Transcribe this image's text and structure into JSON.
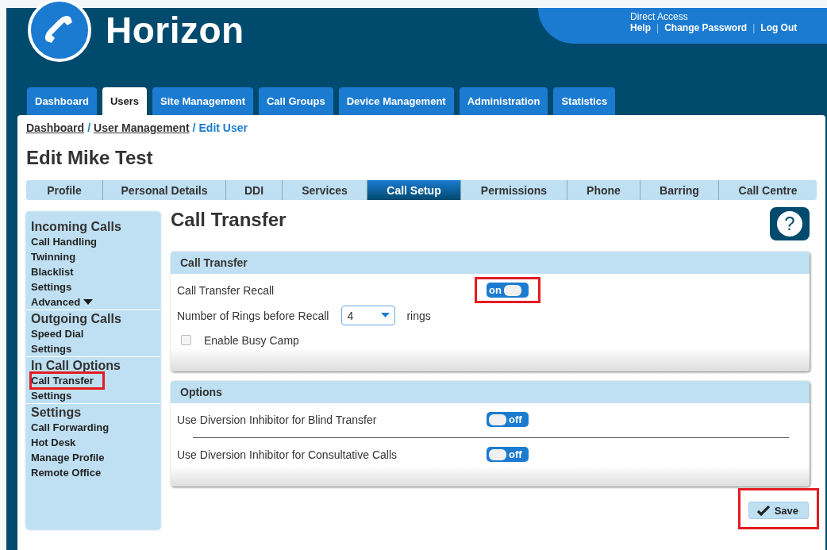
{
  "header": {
    "logo_text": "Horizon",
    "account_label": "Direct Access",
    "account_links": [
      "Help",
      "Change Password",
      "Log Out"
    ],
    "link_separator": "|"
  },
  "main_tabs": [
    {
      "label": "Dashboard",
      "selected": false
    },
    {
      "label": "Users",
      "selected": true
    },
    {
      "label": "Site Management",
      "selected": false
    },
    {
      "label": "Call Groups",
      "selected": false
    },
    {
      "label": "Device Management",
      "selected": false
    },
    {
      "label": "Administration",
      "selected": false
    },
    {
      "label": "Statistics",
      "selected": false
    }
  ],
  "breadcrumb_separator": "/",
  "breadcrumb": [
    {
      "label": "Dashboard",
      "current": false
    },
    {
      "label": "User Management",
      "current": false
    },
    {
      "label": "Edit User",
      "current": true
    }
  ],
  "page_title": "Edit Mike Test",
  "sub_tabs": [
    {
      "label": "Profile",
      "selected": false
    },
    {
      "label": "Personal Details",
      "selected": false
    },
    {
      "label": "DDI",
      "selected": false
    },
    {
      "label": "Services",
      "selected": false
    },
    {
      "label": "Call Setup",
      "selected": true
    },
    {
      "label": "Permissions",
      "selected": false
    },
    {
      "label": "Phone",
      "selected": false
    },
    {
      "label": "Barring",
      "selected": false
    },
    {
      "label": "Call Centre",
      "selected": false
    }
  ],
  "sidebar": [
    {
      "heading": "Incoming Calls",
      "items": [
        {
          "label": "Call Handling",
          "highlighted": false
        },
        {
          "label": "Twinning",
          "highlighted": false
        },
        {
          "label": "Blacklist",
          "highlighted": false
        },
        {
          "label": "Settings",
          "highlighted": false
        },
        {
          "label": "Advanced",
          "highlighted": false,
          "dropdown": true
        }
      ]
    },
    {
      "heading": "Outgoing Calls",
      "items": [
        {
          "label": "Speed Dial",
          "highlighted": false
        },
        {
          "label": "Settings",
          "highlighted": false
        }
      ]
    },
    {
      "heading": "In Call Options",
      "items": [
        {
          "label": "Call Transfer",
          "highlighted": true
        },
        {
          "label": "Settings",
          "highlighted": false
        }
      ]
    },
    {
      "heading": "Settings",
      "items": [
        {
          "label": "Call Forwarding",
          "highlighted": false
        },
        {
          "label": "Hot Desk",
          "highlighted": false
        },
        {
          "label": "Manage Profile",
          "highlighted": false
        },
        {
          "label": "Remote Office",
          "highlighted": false
        }
      ]
    }
  ],
  "section_title": "Call Transfer",
  "help_button": "?",
  "panels": [
    {
      "title": "Call Transfer",
      "rows": [
        {
          "kind": "toggle",
          "label": "Call Transfer Recall",
          "on": true,
          "text": "on",
          "highlighted": true
        },
        {
          "kind": "select",
          "label": "Number of Rings before Recall",
          "value": "4",
          "unit": "rings"
        },
        {
          "kind": "checkbox",
          "label": "Enable Busy Camp",
          "checked": false
        }
      ]
    },
    {
      "title": "Options",
      "rows": [
        {
          "kind": "toggle",
          "label": "Use Diversion Inhibitor for Blind Transfer",
          "on": false,
          "text": "off",
          "highlighted": false
        },
        {
          "kind": "divider"
        },
        {
          "kind": "toggle",
          "label": "Use Diversion Inhibitor for Consultative Calls",
          "on": false,
          "text": "off",
          "highlighted": false
        }
      ]
    }
  ],
  "save_button": {
    "label": "Save",
    "highlighted": true
  }
}
